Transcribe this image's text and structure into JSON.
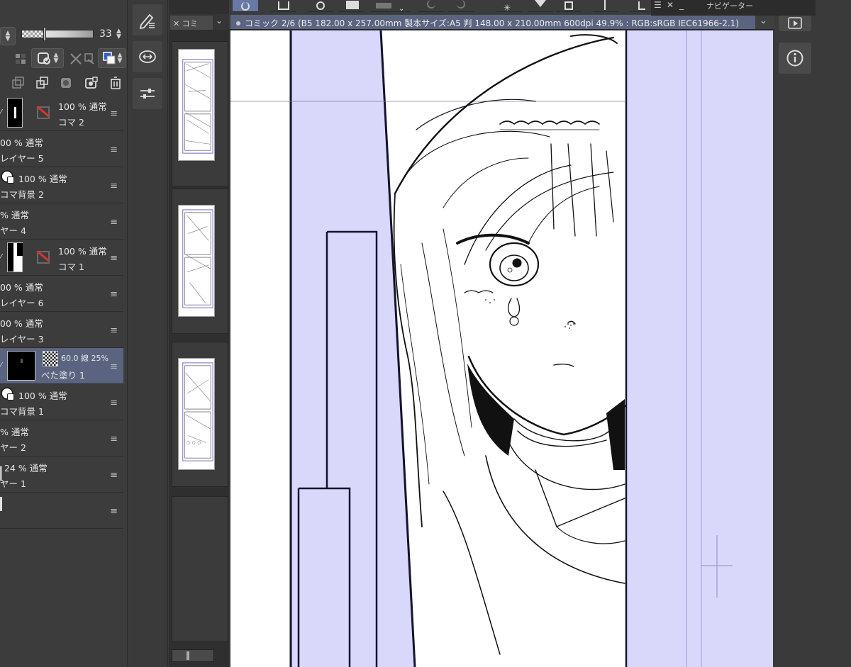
{
  "layer_panel": {
    "opacity_value": "33",
    "layers": [
      {
        "opacity": "100 % 通常",
        "name": "コマ 2",
        "kind": "frame"
      },
      {
        "opacity": "00 % 通常",
        "name": "レイヤー 5",
        "kind": "plain"
      },
      {
        "opacity": "100 % 通常",
        "name": "コマ背景 2",
        "kind": "folder"
      },
      {
        "opacity": "% 通常",
        "name": "ヤー 4",
        "kind": "plain"
      },
      {
        "opacity": "100 % 通常",
        "name": "コマ 1",
        "kind": "frame"
      },
      {
        "opacity": "00 % 通常",
        "name": "レイヤー 6",
        "kind": "plain"
      },
      {
        "opacity": "00 % 通常",
        "name": "レイヤー 3",
        "kind": "plain"
      },
      {
        "opacity": "60.0 線 25%",
        "name": "べた塗り 1",
        "kind": "fill",
        "selected": true
      },
      {
        "opacity": "100 % 通常",
        "name": "コマ背景 1",
        "kind": "folder"
      },
      {
        "opacity": "% 通常",
        "name": "ヤー 2",
        "kind": "plain"
      },
      {
        "opacity": "24 % 通常",
        "name": "ヤー 1",
        "kind": "plain"
      },
      {
        "opacity": "",
        "name": "",
        "kind": "paper"
      }
    ]
  },
  "page_browser": {
    "tab_label": "コミ"
  },
  "canvas": {
    "tab_title": "コミック 2/6 (B5 182.00 x 257.00mm 製本サイズ:A5 判 148.00 x 210.00mm 600dpi 49.9% : RGB:sRGB IEC61966-2.1)"
  },
  "navigator": {
    "title": "ナビゲーター"
  },
  "colors": {
    "panel_bg": "#3c3c3c",
    "selected_row": "#5a6480",
    "canvas_margin": "#d9d8fb",
    "frame_line": "#1b1b3a",
    "active_tool": "#6879a6"
  },
  "icons": [
    "pen-settings-icon",
    "layer-move-icon",
    "slider-settings-icon",
    "animation-icon",
    "info-icon",
    "close-icon",
    "menu-icon",
    "chevron-down-icon",
    "trash-icon"
  ]
}
